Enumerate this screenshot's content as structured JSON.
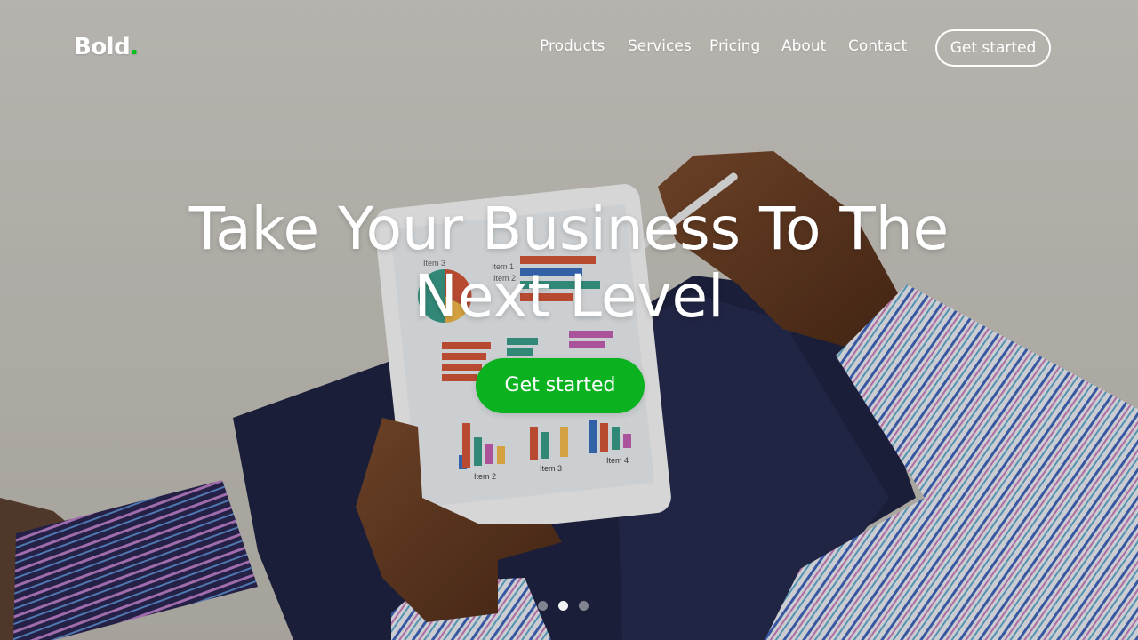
{
  "brand": {
    "name": "Bold",
    "dot": ".",
    "accent_color": "#00c21a"
  },
  "nav": {
    "items": [
      {
        "label": "Products"
      },
      {
        "label": "Services"
      },
      {
        "label": "Pricing"
      },
      {
        "label": "About"
      },
      {
        "label": "Contact"
      }
    ],
    "cta_label": "Get started"
  },
  "hero": {
    "headline": "Take Your Business To The Next Level",
    "cta_label": "Get started",
    "cta_color": "#0ab21f",
    "background_image": "person-holding-tablet-with-charts",
    "tablet_labels": {
      "item3_top": "Item 3",
      "item1": "Item 1",
      "item2_top": "Item 2",
      "item2": "Item 2",
      "item3": "Item 3",
      "item4": "Item 4"
    }
  },
  "carousel": {
    "slides": 3,
    "active_index": 1
  }
}
